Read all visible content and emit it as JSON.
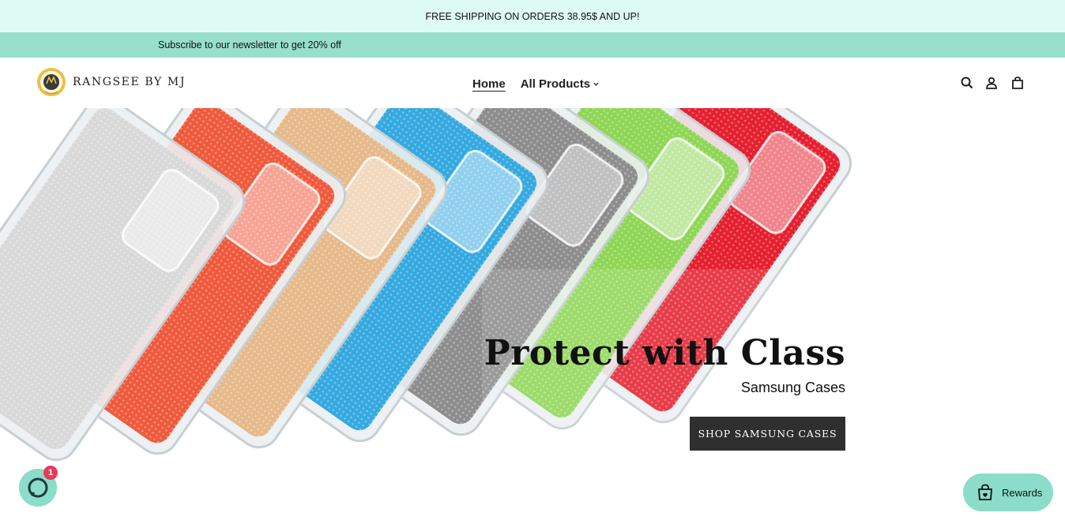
{
  "announcement": {
    "text": "FREE SHIPPING ON ORDERS 38.95$ AND UP!"
  },
  "subscribe": {
    "text": "Subscribe to our newsletter to get 20% off"
  },
  "header": {
    "logo_text": "RANGSEE BY MJ",
    "nav": {
      "home": "Home",
      "all_products": "All Products"
    },
    "icons": [
      "search-icon",
      "account-icon",
      "cart-icon"
    ]
  },
  "hero": {
    "title": "Protect with Class",
    "subtitle": "Samsung Cases",
    "button": "SHOP SAMSUNG CASES",
    "case_colors": [
      "#d9d9d9",
      "#f05a3c",
      "#e6b98a",
      "#35a9e0",
      "#8d8d8d",
      "#8fd656",
      "#e5202f"
    ]
  },
  "chat": {
    "badge": "1"
  },
  "rewards": {
    "label": "Rewards"
  },
  "colors": {
    "announce_bg": "#ddfbf3",
    "subscribe_bg": "#97dfcb",
    "widget_bg": "#8bdcc8",
    "button_bg": "#2f2f2f"
  }
}
